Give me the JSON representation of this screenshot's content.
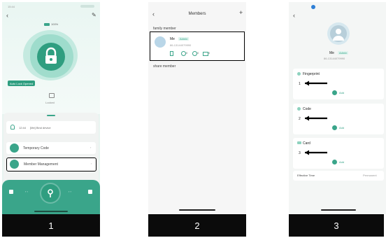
{
  "captions": [
    "1",
    "2",
    "3"
  ],
  "screen1": {
    "status_time": "15:44",
    "battery_label": "100%",
    "auto_lock_label": "Auto Lock Opened",
    "lock_status": "Locked",
    "recent_event": {
      "time": "12:44",
      "text": "[Me] Bind device"
    },
    "menu": [
      {
        "label": "Temporary Code"
      },
      {
        "label": "Member Management"
      }
    ]
  },
  "screen2": {
    "title": "Members",
    "family_header": "family member",
    "member": {
      "name": "Me",
      "badge": "Admin",
      "phone": "86-13144079990",
      "counts": [
        "0",
        "0",
        "0"
      ]
    },
    "share_header": "share member"
  },
  "screen3": {
    "user_name": "Me",
    "badge": "Admin",
    "phone": "86-13144079990",
    "sections": [
      {
        "title": "Fingerprint",
        "item": "1",
        "add": "Add"
      },
      {
        "title": "Code",
        "item": "2",
        "add": "Add"
      },
      {
        "title": "Card",
        "item": "3",
        "add": "Add"
      }
    ],
    "effective_label": "Effective Time",
    "effective_value": "Permanent"
  },
  "colors": {
    "accent": "#3aa58a",
    "light_mint": "#dff4ee",
    "dark_bar": "#0b0b0b"
  }
}
